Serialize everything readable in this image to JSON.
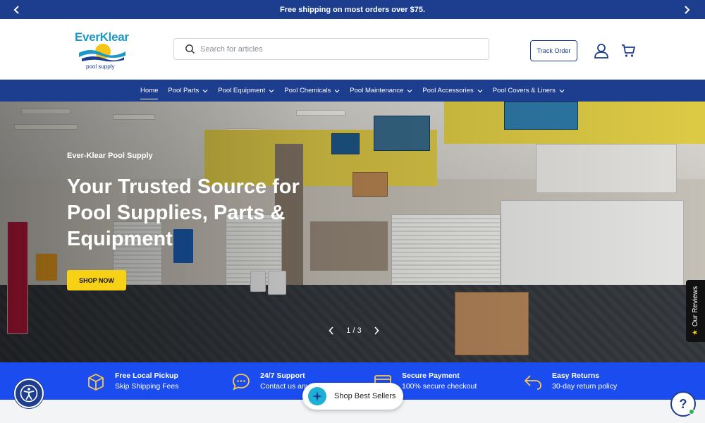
{
  "announcement": {
    "text": "Free shipping on most orders over $75.",
    "prev_icon": "chevron-left-icon",
    "next_icon": "chevron-right-icon"
  },
  "header": {
    "logo": {
      "brand": "EverKlear",
      "tagline": "pool supply"
    },
    "search": {
      "placeholder": "Search for articles",
      "value": ""
    },
    "track_order_label": "Track Order",
    "account_icon": "user-icon",
    "cart_icon": "cart-icon"
  },
  "nav": {
    "items": [
      {
        "label": "Home",
        "active": true,
        "has_dropdown": false
      },
      {
        "label": "Pool Parts",
        "has_dropdown": true
      },
      {
        "label": "Pool Equipment",
        "has_dropdown": true
      },
      {
        "label": "Pool Chemicals",
        "has_dropdown": true
      },
      {
        "label": "Pool Maintenance",
        "has_dropdown": true
      },
      {
        "label": "Pool Accessories",
        "has_dropdown": true
      },
      {
        "label": "Pool Covers & Liners",
        "has_dropdown": true
      }
    ]
  },
  "hero": {
    "kicker": "Ever-Klear Pool Supply",
    "headline": "Your Trusted Source for Pool Supplies, Parts & Equipment",
    "cta_label": "SHOP NOW",
    "pager": {
      "current": 1,
      "total": 3,
      "text": "1 / 3"
    }
  },
  "reviews_tab": {
    "label": "Our Reviews",
    "star": "★"
  },
  "features": [
    {
      "icon": "box-icon",
      "title": "Free Local Pickup",
      "subtitle": "Skip Shipping Fees"
    },
    {
      "icon": "chat-icon",
      "title": "24/7 Support",
      "subtitle": "Contact us anytime"
    },
    {
      "icon": "credit-card-icon",
      "title": "Secure Payment",
      "subtitle": "100% secure checkout"
    },
    {
      "icon": "return-arrow-icon",
      "title": "Easy Returns",
      "subtitle": "30-day return policy"
    }
  ],
  "best_sellers": {
    "label": "Shop Best Sellers",
    "icon": "sparkle-icon"
  },
  "help": {
    "label": "?"
  },
  "colors": {
    "navy": "#1d3d8f",
    "feature_blue": "#1b4cf0",
    "cta_yellow": "#f7d115",
    "logo_teal": "#1d97c6"
  }
}
